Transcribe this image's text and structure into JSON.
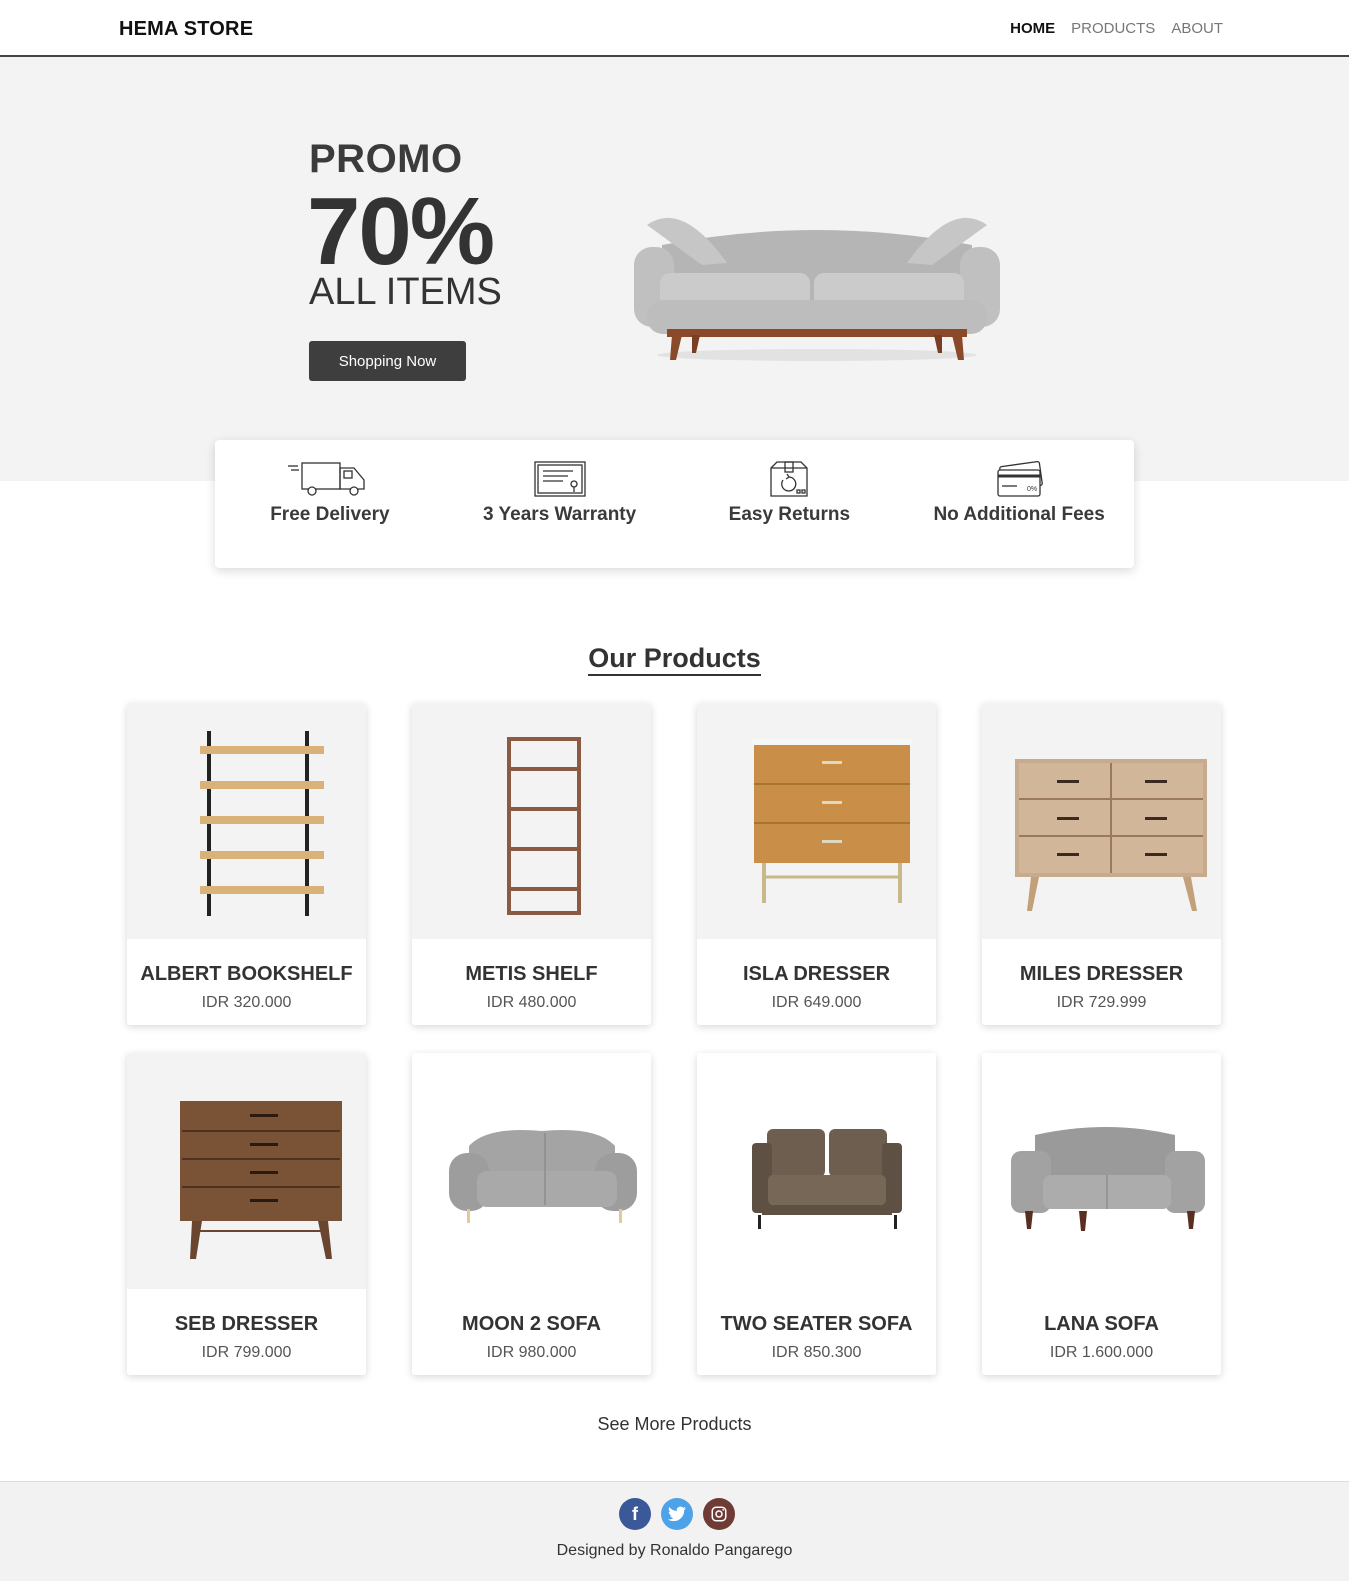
{
  "nav": {
    "brand": "HEMA STORE",
    "links": [
      "HOME",
      "PRODUCTS",
      "ABOUT"
    ]
  },
  "hero": {
    "promo": "PROMO",
    "percent": "70%",
    "subtitle": "ALL ITEMS",
    "button": "Shopping Now"
  },
  "features": [
    "Free Delivery",
    "3 Years Warranty",
    "Easy Returns",
    "No Additional Fees"
  ],
  "products": {
    "title": "Our Products",
    "items": [
      {
        "name": "ALBERT BOOKSHELF",
        "price": "IDR 320.000"
      },
      {
        "name": "METIS SHELF",
        "price": "IDR 480.000"
      },
      {
        "name": "ISLA DRESSER",
        "price": "IDR 649.000"
      },
      {
        "name": "MILES DRESSER",
        "price": "IDR 729.999"
      },
      {
        "name": "SEB DRESSER",
        "price": "IDR 799.000"
      },
      {
        "name": "MOON 2 SOFA",
        "price": "IDR 980.000"
      },
      {
        "name": "TWO SEATER SOFA",
        "price": "IDR 850.300"
      },
      {
        "name": "LANA SOFA",
        "price": "IDR 1.600.000"
      }
    ],
    "see_more": "See More Products"
  },
  "footer": {
    "socials": [
      "facebook-icon",
      "twitter-icon",
      "instagram-icon"
    ],
    "credit": "Designed by Ronaldo Pangarego"
  }
}
